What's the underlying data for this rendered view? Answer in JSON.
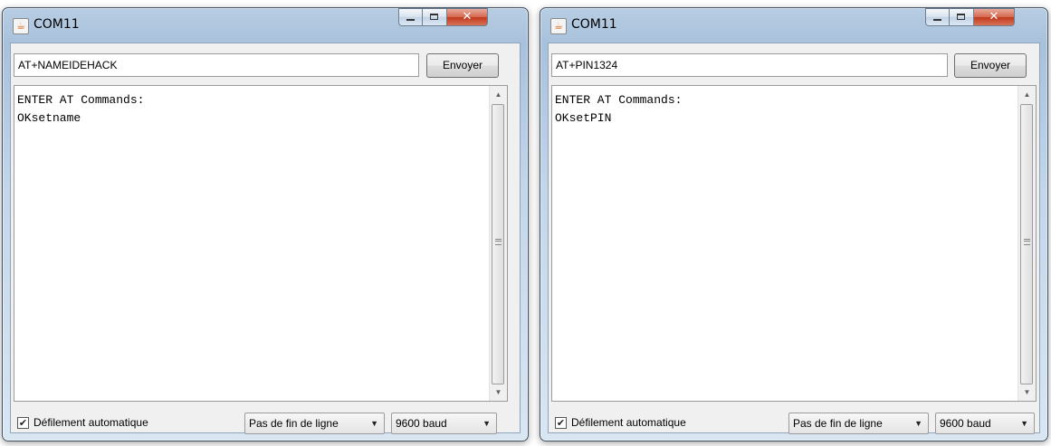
{
  "windows": [
    {
      "title": "COM11",
      "command_value": "AT+NAMEIDEHACK",
      "send_label": "Envoyer",
      "output_lines": [
        "ENTER AT Commands:",
        "OKsetname"
      ],
      "autoscroll_label": "Défilement automatique",
      "autoscroll_checked": true,
      "line_ending": "Pas de fin de ligne",
      "baud_rate": "9600 baud"
    },
    {
      "title": "COM11",
      "command_value": "AT+PIN1324",
      "send_label": "Envoyer",
      "output_lines": [
        "ENTER AT Commands:",
        "OKsetPIN"
      ],
      "autoscroll_label": "Défilement automatique",
      "autoscroll_checked": true,
      "line_ending": "Pas de fin de ligne",
      "baud_rate": "9600 baud"
    }
  ],
  "icons": {
    "app": "java-cup-icon",
    "minimize": "minimize-icon",
    "maximize": "maximize-icon",
    "close": "close-icon",
    "dropdown": "dropdown-arrow-icon"
  },
  "colors": {
    "title_bar": "#b7cde3",
    "close_button": "#c0391d",
    "client_bg": "#f0f0f0"
  }
}
